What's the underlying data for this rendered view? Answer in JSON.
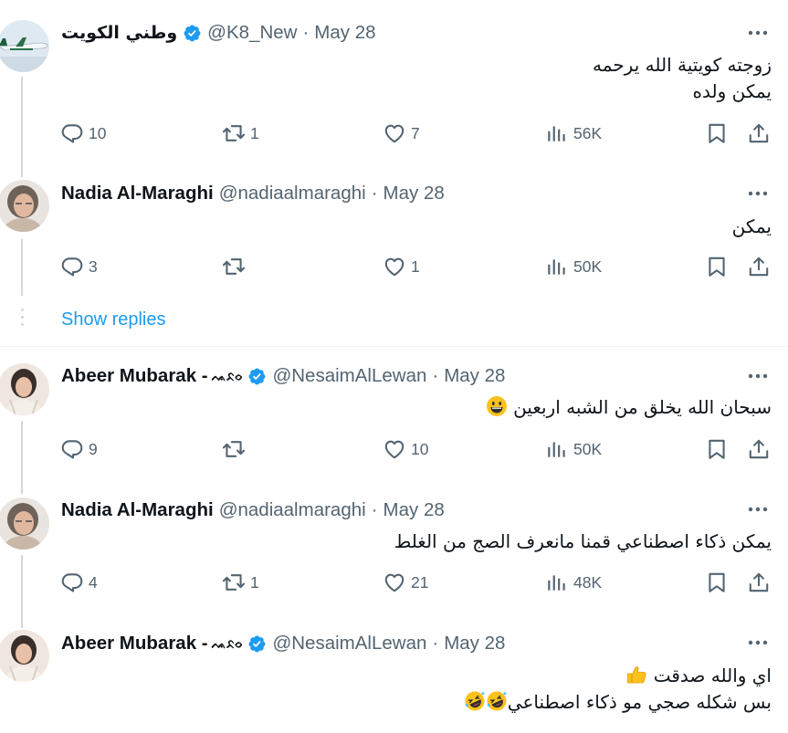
{
  "tweets": [
    {
      "name": "وطني الكويت",
      "verified": true,
      "handle": "@K8_New",
      "sep": "·",
      "date": "May 28",
      "lines": [
        "زوجته كويتية الله يرحمه",
        "يمكن ولده"
      ],
      "replies": "10",
      "retweets": "1",
      "likes": "7",
      "views": "56K"
    },
    {
      "name": "Nadia Al-Maraghi",
      "verified": false,
      "handle": "@nadiaalmaraghi",
      "sep": "·",
      "date": "May 28",
      "lines": [
        "يمكن"
      ],
      "replies": "3",
      "retweets": "",
      "likes": "1",
      "views": "50K"
    },
    {
      "name": "Abeer Mubarak -",
      "emblem": "ᨕᨅᨔ",
      "verified": true,
      "handle": "@NesaimAlLewan",
      "sep": "·",
      "date": "May 28",
      "lines": [
        "سبحان الله يخلق من الشبه اربعين"
      ],
      "replies": "9",
      "retweets": "",
      "likes": "10",
      "views": "50K"
    },
    {
      "name": "Nadia Al-Maraghi",
      "verified": false,
      "handle": "@nadiaalmaraghi",
      "sep": "·",
      "date": "May 28",
      "lines": [
        "يمكن ذكاء اصطناعي قمنا مانعرف الصج من الغلط"
      ],
      "replies": "4",
      "retweets": "1",
      "likes": "21",
      "views": "48K"
    },
    {
      "name": "Abeer Mubarak -",
      "emblem": "ᨕᨅᨔ",
      "verified": true,
      "handle": "@NesaimAlLewan",
      "sep": "·",
      "date": "May 28",
      "lines": [
        "اي والله صدقت",
        "بس شكله صجي مو ذكاء اصطناعي"
      ]
    }
  ],
  "show_replies": "Show replies",
  "colors": {
    "accent": "#1d9bf0",
    "muted": "#536471",
    "text": "#0f1419",
    "line": "#cfd9de"
  },
  "icons": [
    "verified-badge-icon",
    "more-icon",
    "reply-icon",
    "retweet-icon",
    "like-icon",
    "views-icon",
    "bookmark-icon",
    "share-icon",
    "grinning-face-emoji",
    "thumbs-up-emoji",
    "rolling-laughing-emoji"
  ]
}
